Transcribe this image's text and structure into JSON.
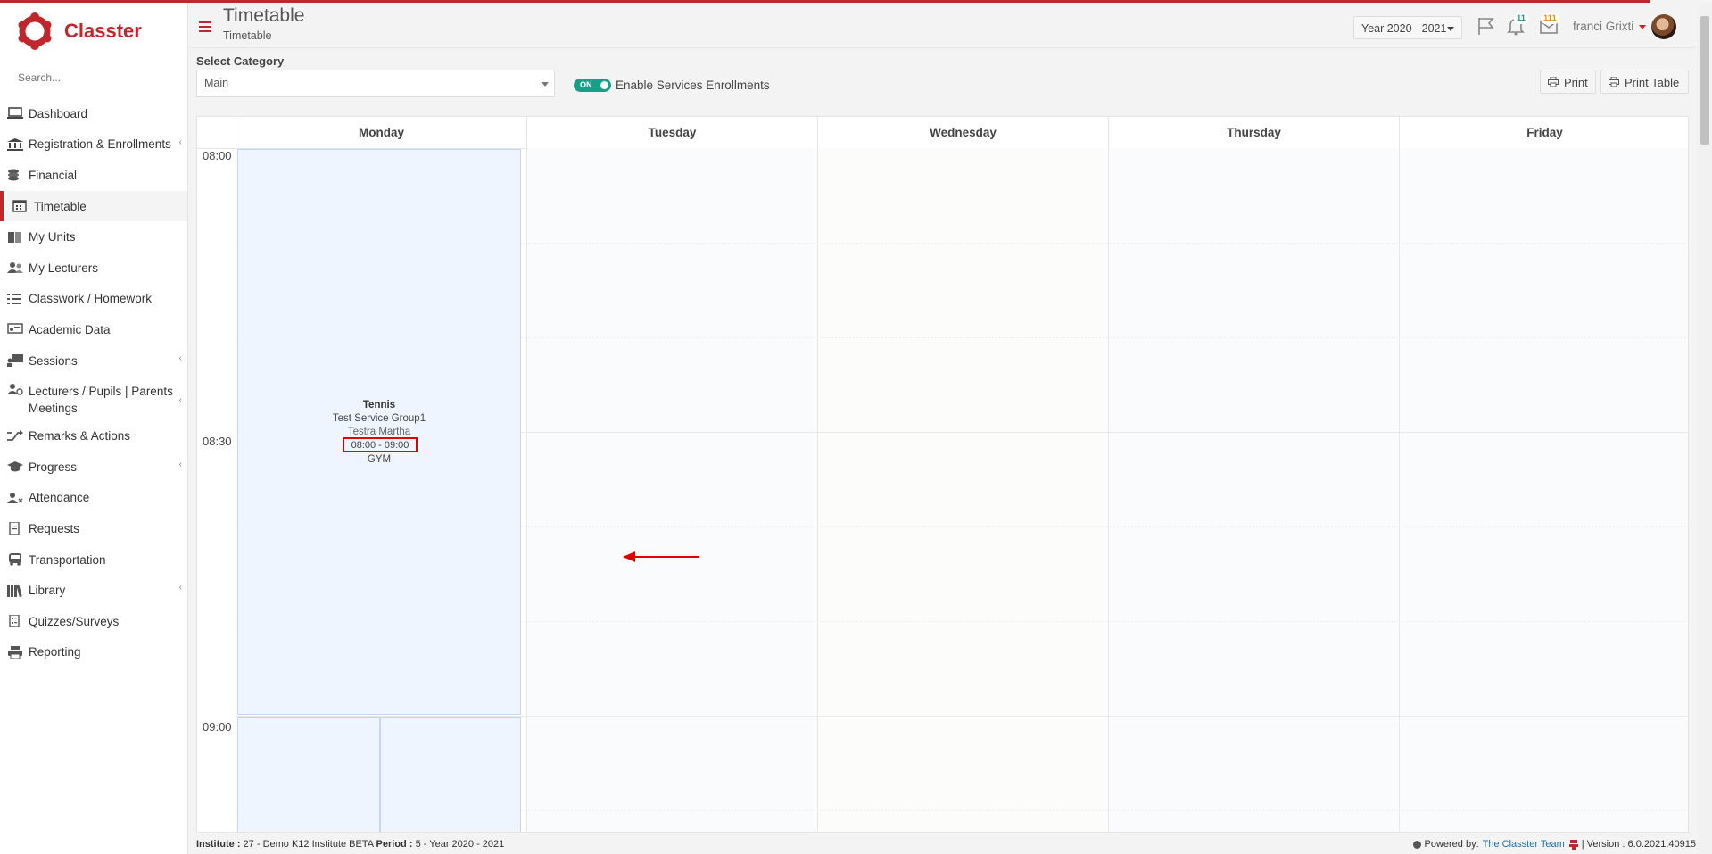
{
  "brand": {
    "name": "Classter"
  },
  "search": {
    "placeholder": "Search..."
  },
  "sidebar": {
    "items": [
      {
        "label": "Dashboard",
        "icon": "monitor-icon"
      },
      {
        "label": "Registration & Enrollments",
        "icon": "institution-icon"
      },
      {
        "label": "Financial",
        "icon": "coins-icon"
      },
      {
        "label": "Timetable",
        "icon": "calendar-icon"
      },
      {
        "label": "My Units",
        "icon": "book-icon"
      },
      {
        "label": "My Lecturers",
        "icon": "users-icon"
      },
      {
        "label": "Classwork / Homework",
        "icon": "tasks-icon"
      },
      {
        "label": "Academic Data",
        "icon": "chalkboard-icon"
      },
      {
        "label": "Sessions",
        "icon": "presentation-icon"
      },
      {
        "label": "Lecturers / Pupils | Parents Meetings",
        "icon": "meeting-icon"
      },
      {
        "label": "Remarks & Actions",
        "icon": "random-icon"
      },
      {
        "label": "Progress",
        "icon": "graduation-cap-icon"
      },
      {
        "label": "Attendance",
        "icon": "user-x-icon"
      },
      {
        "label": "Requests",
        "icon": "file-icon"
      },
      {
        "label": "Transportation",
        "icon": "bus-icon"
      },
      {
        "label": "Library",
        "icon": "library-icon"
      },
      {
        "label": "Quizzes/Surveys",
        "icon": "survey-icon"
      },
      {
        "label": "Reporting",
        "icon": "print-icon"
      }
    ]
  },
  "header": {
    "title": "Timetable",
    "subtitle": "Timetable",
    "year": "Year 2020 - 2021",
    "notifications_count": "11",
    "messages_count": "111",
    "user_name": "franci Grixti"
  },
  "controls": {
    "category_label": "Select Category",
    "category_value": "Main",
    "toggle_state": "ON",
    "toggle_label": "Enable Services Enrollments",
    "print_label": "Print",
    "print_table_label": "Print Table"
  },
  "calendar": {
    "days": [
      "Monday",
      "Tuesday",
      "Wednesday",
      "Thursday",
      "Friday"
    ],
    "times": [
      "08:00",
      "08:30",
      "09:00"
    ],
    "event": {
      "title": "Tennis",
      "group": "Test Service Group1",
      "teacher": "Testra Martha",
      "time": "08:00 - 09:00",
      "room": "GYM"
    }
  },
  "footer": {
    "institute_label": "Institute :",
    "institute_value": "27 - Demo K12 Institute BETA",
    "period_label": "Period :",
    "period_value": "5 - Year 2020 - 2021",
    "powered_label": "Powered by:",
    "powered_link": "The Classter Team",
    "version": "| Version : 6.0.2021.40915"
  },
  "colors": {
    "accent": "#c0272d",
    "toggle": "#17a087",
    "event_bg": "#eef5fe",
    "highlight": "#e00000"
  }
}
